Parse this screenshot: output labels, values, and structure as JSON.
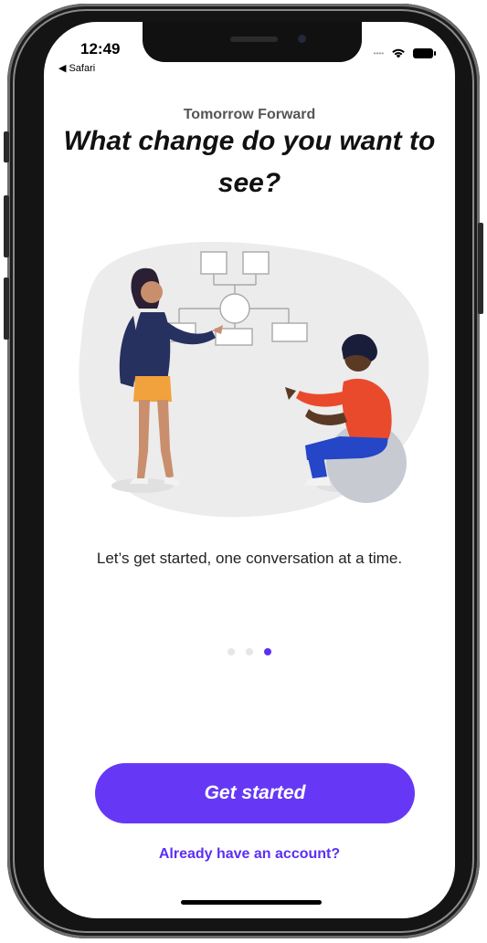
{
  "status_bar": {
    "time": "12:49",
    "back_label": "Safari"
  },
  "app": {
    "name": "Tomorrow Forward"
  },
  "onboarding": {
    "headline": "What change do you want to see?",
    "caption": "Let’s get started, one conversation at a time.",
    "pagination": {
      "total": 3,
      "current": 3
    }
  },
  "actions": {
    "primary_label": "Get started",
    "secondary_label": "Already have an account?"
  },
  "colors": {
    "accent": "#6638f6",
    "link": "#5b2ff5"
  },
  "icons": [
    "back-chevron-icon",
    "wifi-icon",
    "battery-icon",
    "cellular-icon"
  ]
}
